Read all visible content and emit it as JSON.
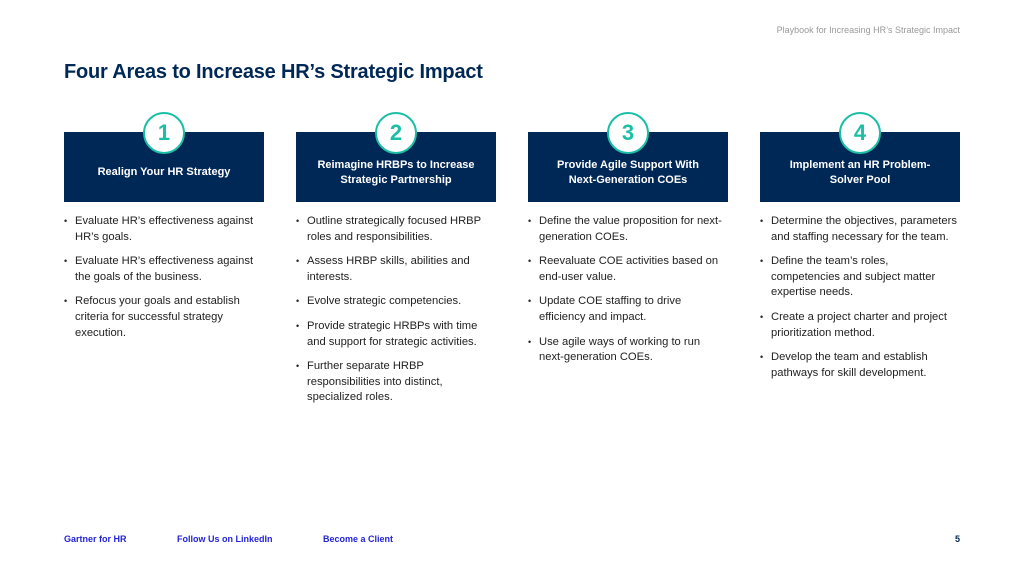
{
  "header": {
    "running_title": "Playbook for Increasing HR’s Strategic Impact",
    "title": "Four Areas to Increase HR’s Strategic Impact"
  },
  "areas": [
    {
      "number": "1",
      "title": "Realign Your HR Strategy",
      "bullets": [
        "Evaluate HR’s effectiveness against HR’s goals.",
        "Evaluate HR’s effectiveness against the goals of the business.",
        "Refocus your goals and establish criteria for successful strategy execution."
      ]
    },
    {
      "number": "2",
      "title": "Reimagine HRBPs to Increase Strategic Partnership",
      "bullets": [
        "Outline strategically focused HRBP roles and responsibilities.",
        "Assess HRBP skills, abilities and interests.",
        "Evolve strategic competencies.",
        "Provide strategic HRBPs with time and support for strategic activities.",
        "Further separate HRBP responsibilities into distinct, specialized roles."
      ]
    },
    {
      "number": "3",
      "title": "Provide Agile Support With Next-Generation COEs",
      "bullets": [
        "Define the value proposition for next-generation COEs.",
        "Reevaluate COE activities based on end-user value.",
        "Update COE staffing to drive efficiency and impact.",
        "Use agile ways of working to run next-generation COEs."
      ]
    },
    {
      "number": "4",
      "title": "Implement an HR Problem-Solver Pool",
      "bullets": [
        "Determine the objectives, parameters and staffing necessary for the team.",
        "Define the team’s roles, competencies and subject matter expertise needs.",
        "Create a project charter and project prioritization method.",
        "Develop the team and establish pathways for skill development."
      ]
    }
  ],
  "footer": {
    "link1": "Gartner for HR",
    "link2": "Follow Us on LinkedIn",
    "link3": "Become a Client",
    "page": "5"
  }
}
